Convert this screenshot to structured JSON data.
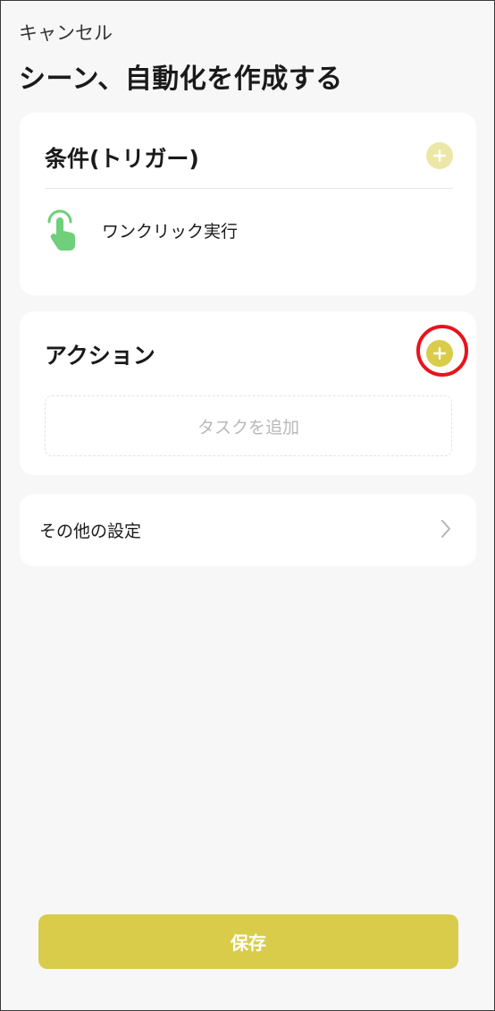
{
  "header": {
    "cancel_label": "キャンセル",
    "title": "シーン、自動化を作成する"
  },
  "trigger_card": {
    "heading": "条件(トリガー)",
    "add_icon": "plus-circle-icon",
    "items": [
      {
        "icon": "tap-hand-icon",
        "label": "ワンクリック実行"
      }
    ]
  },
  "action_card": {
    "heading": "アクション",
    "add_icon": "plus-circle-icon",
    "task_placeholder": "タスクを追加"
  },
  "other_settings": {
    "label": "その他の設定",
    "icon": "chevron-right-icon"
  },
  "footer": {
    "save_label": "保存"
  },
  "colors": {
    "accent": "#d9cc4b",
    "accent_light": "#ebe7a7",
    "hand_icon": "#6fcf7a",
    "highlight": "#e8141b",
    "background": "#f7f7f7"
  }
}
